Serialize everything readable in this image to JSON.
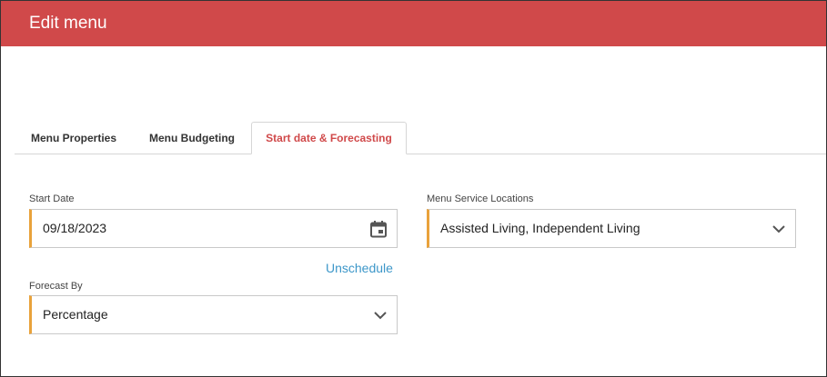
{
  "header": {
    "title": "Edit menu"
  },
  "tabs": [
    {
      "label": "Menu Properties"
    },
    {
      "label": "Menu Budgeting"
    },
    {
      "label": "Start date & Forecasting"
    }
  ],
  "form": {
    "start_date": {
      "label": "Start Date",
      "value": "09/18/2023",
      "icon": "calendar-icon"
    },
    "unschedule_link": "Unschedule",
    "forecast_by": {
      "label": "Forecast By",
      "value": "Percentage",
      "icon": "chevron-down-icon"
    },
    "service_locations": {
      "label": "Menu Service Locations",
      "value": "Assisted Living, Independent Living",
      "icon": "chevron-down-icon"
    }
  },
  "colors": {
    "header_bg": "#d0494a",
    "active_tab": "#d0494a",
    "field_accent": "#e9a23b",
    "link": "#3d97c9"
  }
}
